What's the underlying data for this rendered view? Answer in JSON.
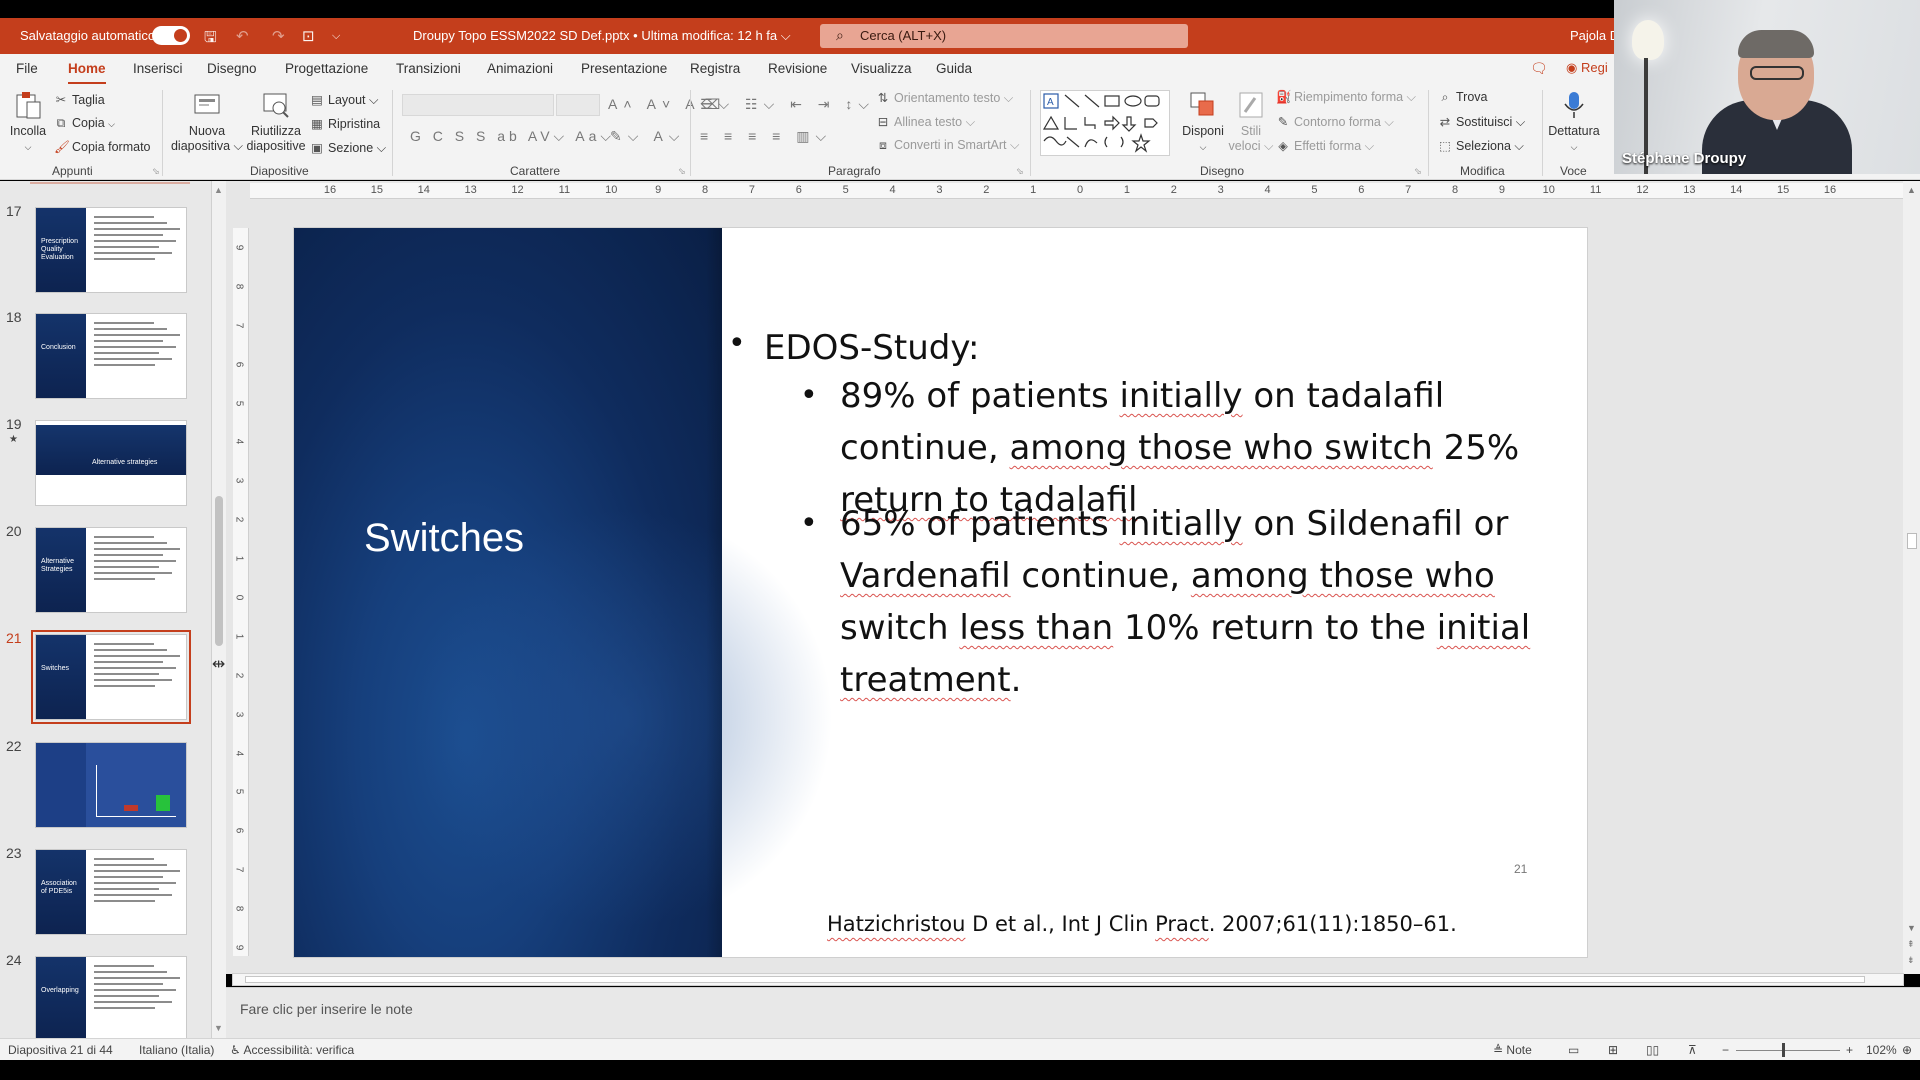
{
  "titlebar": {
    "autosave_label": "Salvataggio automatico",
    "filename": "Droupy Topo ESSM2022 SD Def.pptx  •  Ultima modifica: 12 h fa ⌵",
    "search_placeholder": "Cerca (ALT+X)",
    "user": "Pajola D"
  },
  "menu": {
    "tabs": [
      "File",
      "Home",
      "Inserisci",
      "Disegno",
      "Progettazione",
      "Transizioni",
      "Animazioni",
      "Presentazione",
      "Registra",
      "Revisione",
      "Visualizza",
      "Guida"
    ],
    "active": "Home",
    "record_label": "Regi"
  },
  "ribbon": {
    "appunti": {
      "paste": "Incolla",
      "cut": "Taglia",
      "copy": "Copia",
      "format_painter": "Copia formato",
      "label": "Appunti"
    },
    "diapositive": {
      "new_slide_1": "Nuova",
      "new_slide_2": "diapositiva ⌵",
      "reuse_1": "Riutilizza",
      "reuse_2": "diapositive",
      "layout": "Layout ⌵",
      "reset": "Ripristina",
      "section": "Sezione ⌵",
      "label": "Diapositive"
    },
    "carattere": {
      "label": "Carattere",
      "styles": "G C S S ab AV⌵ Aa⌵"
    },
    "paragrafo": {
      "text_direction": "Orientamento testo ⌵",
      "align_text": "Allinea testo ⌵",
      "smartart": "Converti in SmartArt ⌵",
      "label": "Paragrafo"
    },
    "disegno": {
      "arrange": "Disponi",
      "quick_styles_1": "Stili",
      "quick_styles_2": "veloci ⌵",
      "fill": "Riempimento forma ⌵",
      "outline": "Contorno forma ⌵",
      "effects": "Effetti forma ⌵",
      "label": "Disegno"
    },
    "modifica": {
      "find": "Trova",
      "replace": "Sostituisci ⌵",
      "select": "Seleziona ⌵",
      "label": "Modifica"
    },
    "voce": {
      "dictate": "Dettatura",
      "label": "Voce"
    }
  },
  "webcam": {
    "name": "Stéphane Droupy"
  },
  "thumbnails": [
    {
      "num": "17",
      "title": "Prescription Quality Evaluation",
      "style": "side"
    },
    {
      "num": "18",
      "title": "Conclusion",
      "style": "side"
    },
    {
      "num": "19",
      "title": "Alternative strategies",
      "style": "band",
      "star": "★"
    },
    {
      "num": "20",
      "title": "Alternative Strategies",
      "style": "side"
    },
    {
      "num": "21",
      "title": "Switches",
      "style": "side",
      "selected": true
    },
    {
      "num": "22",
      "title": "",
      "style": "chart"
    },
    {
      "num": "23",
      "title": "Association of PDE5is",
      "style": "side"
    },
    {
      "num": "24",
      "title": "Overlapping",
      "style": "side"
    }
  ],
  "ruler": {
    "h": [
      "16",
      "15",
      "14",
      "13",
      "12",
      "11",
      "10",
      "9",
      "8",
      "7",
      "6",
      "5",
      "4",
      "3",
      "2",
      "1",
      "0",
      "1",
      "2",
      "3",
      "4",
      "5",
      "6",
      "7",
      "8",
      "9",
      "10",
      "11",
      "12",
      "13",
      "14",
      "15",
      "16"
    ],
    "v": [
      "9",
      "8",
      "7",
      "6",
      "5",
      "4",
      "3",
      "2",
      "1",
      "0",
      "1",
      "2",
      "3",
      "4",
      "5",
      "6",
      "7",
      "8",
      "9"
    ]
  },
  "slide": {
    "title": "Switches",
    "heading": "EDOS-Study:",
    "bullets": [
      [
        "89% of patients ",
        "initially",
        " on ",
        "tadalafil",
        " continue, ",
        "among those who switch",
        " 25% ",
        "return to tadalafil"
      ],
      [
        "65% of patients ",
        "initially",
        " on ",
        "Sildenafil",
        " or ",
        "Vardenafil",
        " continue, ",
        "among those who",
        " switch ",
        "less than",
        " 10% return to the ",
        "initial treatment",
        "."
      ]
    ],
    "citation_a": "Hatzichristou",
    "citation_b": " D et al., Int J Clin ",
    "citation_c": "Pract",
    "citation_d": ". 2007;61(11):1850–61.",
    "number": "21"
  },
  "notes": {
    "placeholder": "Fare clic per inserire le note"
  },
  "status": {
    "slide": "Diapositiva 21 di 44",
    "language": "Italiano (Italia)",
    "accessibility": "Accessibilità: verifica",
    "notes_btn": "Note",
    "zoom": "102%"
  }
}
